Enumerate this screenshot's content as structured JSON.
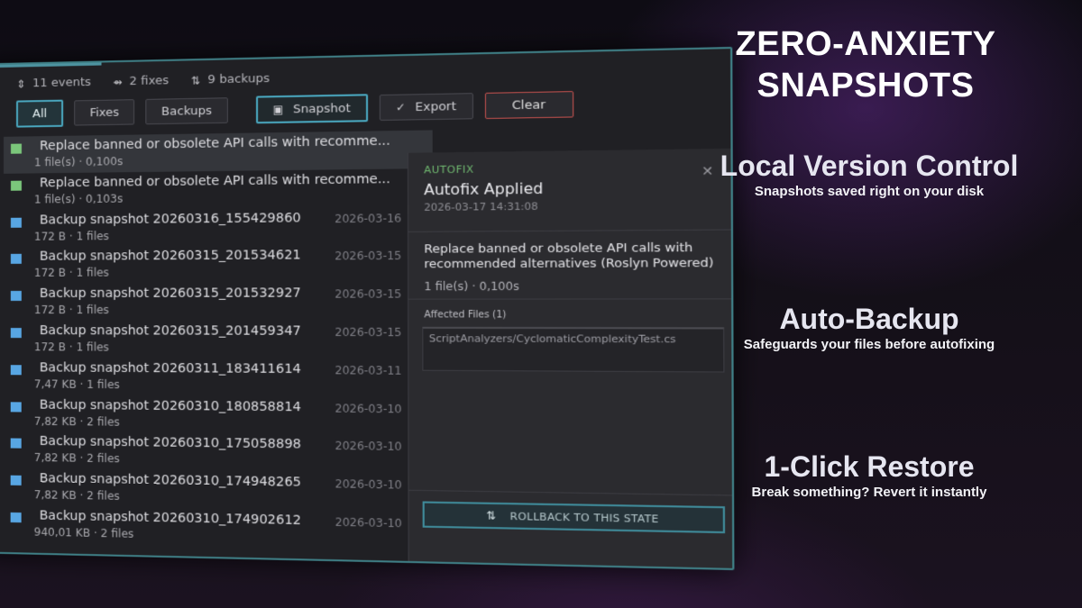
{
  "stats": {
    "events": "11 events",
    "fixes": "2 fixes",
    "backups": "9 backups"
  },
  "filters": {
    "all": "All",
    "fixes": "Fixes",
    "backups": "Backups",
    "snapshot": "Snapshot",
    "export": "Export",
    "clear": "Clear"
  },
  "list": [
    {
      "kind": "fix",
      "title": "Replace banned or obsolete API calls with recomme...",
      "meta": "1 file(s)  ·  0,100s",
      "date": ""
    },
    {
      "kind": "fix",
      "title": "Replace banned or obsolete API calls with recomme...",
      "meta": "1 file(s)  ·  0,103s",
      "date": ""
    },
    {
      "kind": "backup",
      "title": "Backup snapshot 20260316_155429860",
      "meta": "172 B  ·  1 files",
      "date": "2026-03-16"
    },
    {
      "kind": "backup",
      "title": "Backup snapshot 20260315_201534621",
      "meta": "172 B  ·  1 files",
      "date": "2026-03-15"
    },
    {
      "kind": "backup",
      "title": "Backup snapshot 20260315_201532927",
      "meta": "172 B  ·  1 files",
      "date": "2026-03-15"
    },
    {
      "kind": "backup",
      "title": "Backup snapshot 20260315_201459347",
      "meta": "172 B  ·  1 files",
      "date": "2026-03-15"
    },
    {
      "kind": "backup",
      "title": "Backup snapshot 20260311_183411614",
      "meta": "7,47 KB  ·  1 files",
      "date": "2026-03-11"
    },
    {
      "kind": "backup",
      "title": "Backup snapshot 20260310_180858814",
      "meta": "7,82 KB  ·  2 files",
      "date": "2026-03-10"
    },
    {
      "kind": "backup",
      "title": "Backup snapshot 20260310_175058898",
      "meta": "7,82 KB  ·  2 files",
      "date": "2026-03-10"
    },
    {
      "kind": "backup",
      "title": "Backup snapshot 20260310_174948265",
      "meta": "7,82 KB  ·  2 files",
      "date": "2026-03-10"
    },
    {
      "kind": "backup",
      "title": "Backup snapshot 20260310_174902612",
      "meta": "940,01 KB  ·  2 files",
      "date": "2026-03-10"
    }
  ],
  "panel": {
    "kind": "AUTOFIX",
    "title": "Autofix Applied",
    "time": "2026-03-17  14:31:08",
    "description": "Replace banned or obsolete API calls with recommended alternatives (Roslyn Powered)",
    "desc_meta": "1 file(s)  ·  0,100s",
    "affected_label": "Affected Files (1)",
    "file": "ScriptAnalyzers/CyclomaticComplexityTest.cs",
    "rollback": "ROLLBACK TO THIS STATE"
  },
  "hero": {
    "line1": "ZERO-ANXIETY",
    "line2": "SNAPSHOTS"
  },
  "features": [
    {
      "heading": "Local Version Control",
      "sub": "Snapshots saved right on your disk"
    },
    {
      "heading": "Auto-Backup",
      "sub": "Safeguards your files before autofixing"
    },
    {
      "heading": "1-Click Restore",
      "sub": "Break something? Revert it instantly"
    }
  ],
  "colors": {
    "accent": "#4aa8c0",
    "fix": "#7bc77b",
    "backup": "#58a6e3",
    "danger": "#c0504d"
  }
}
